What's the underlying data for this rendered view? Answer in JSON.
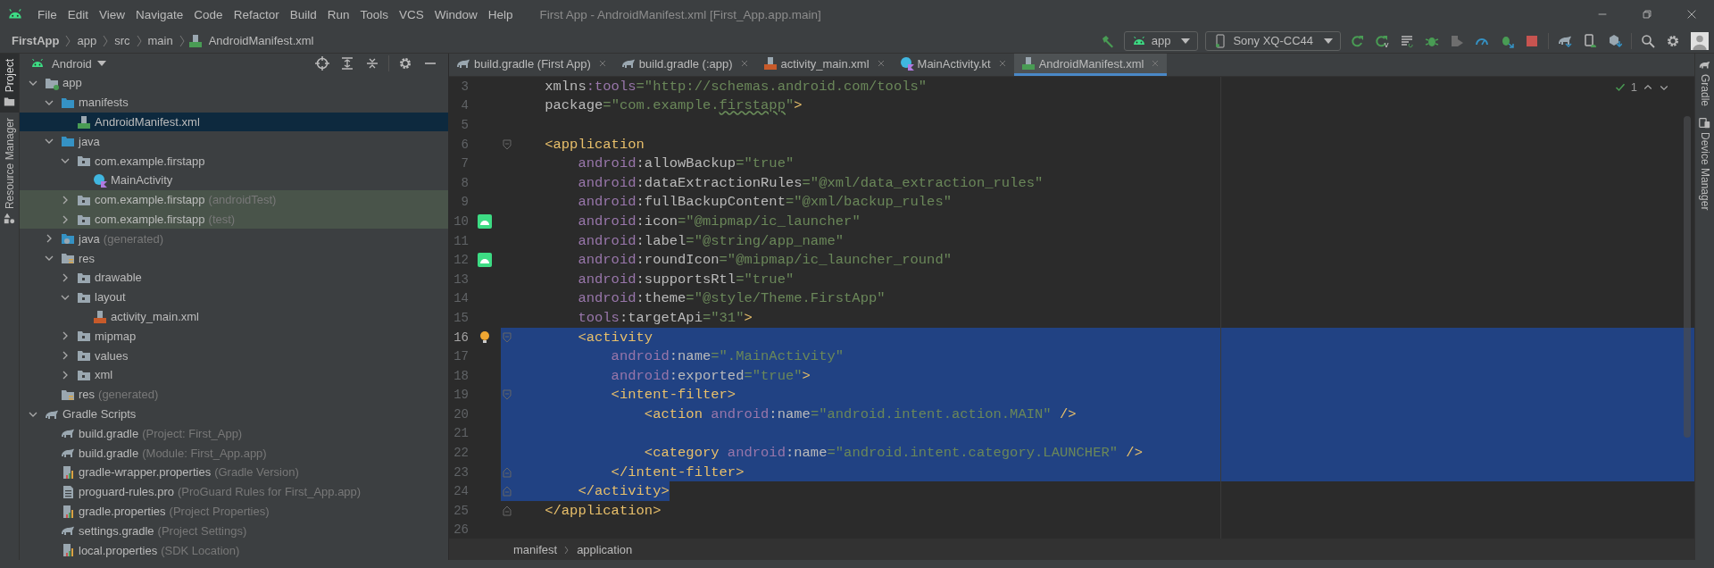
{
  "window": {
    "title": "First App - AndroidManifest.xml [First_App.app.main]"
  },
  "menu": [
    "File",
    "Edit",
    "View",
    "Navigate",
    "Code",
    "Refactor",
    "Build",
    "Run",
    "Tools",
    "VCS",
    "Window",
    "Help"
  ],
  "navbar": {
    "crumbs": [
      "FirstApp",
      "app",
      "src",
      "main",
      "AndroidManifest.xml"
    ],
    "run_config": "app",
    "device": "Sony XQ-CC44"
  },
  "left_stripe": [
    {
      "label": "Project",
      "selected": true
    },
    {
      "label": "Resource Manager",
      "selected": false
    }
  ],
  "right_stripe": [
    {
      "label": "Gradle",
      "selected": false
    },
    {
      "label": "Device Manager",
      "selected": false
    }
  ],
  "project": {
    "view": "Android",
    "tree": [
      {
        "label": "app",
        "kind": "module",
        "expanded": true,
        "selected": false,
        "tinted": false,
        "children": [
          {
            "label": "manifests",
            "kind": "source-folder",
            "expanded": true,
            "selected": false,
            "tinted": false,
            "children": [
              {
                "label": "AndroidManifest.xml",
                "kind": "manifest",
                "selected": true,
                "tinted": false
              }
            ]
          },
          {
            "label": "java",
            "kind": "source-folder",
            "expanded": true,
            "selected": false,
            "tinted": false,
            "children": [
              {
                "label": "com.example.firstapp",
                "kind": "package",
                "expanded": true,
                "selected": false,
                "tinted": false,
                "children": [
                  {
                    "label": "MainActivity",
                    "kind": "class",
                    "selected": false,
                    "tinted": false
                  }
                ]
              },
              {
                "label": "com.example.firstapp",
                "note": "(androidTest)",
                "kind": "package",
                "expanded": false,
                "selected": false,
                "tinted": true
              },
              {
                "label": "com.example.firstapp",
                "note": "(test)",
                "kind": "package",
                "expanded": false,
                "selected": false,
                "tinted": true
              }
            ]
          },
          {
            "label": "java",
            "note": "(generated)",
            "kind": "generated-folder",
            "expanded": false,
            "selected": false,
            "tinted": false
          },
          {
            "label": "res",
            "kind": "resource-folder",
            "expanded": true,
            "selected": false,
            "tinted": false,
            "children": [
              {
                "label": "drawable",
                "kind": "package",
                "expanded": false,
                "selected": false,
                "tinted": false
              },
              {
                "label": "layout",
                "kind": "package",
                "expanded": true,
                "selected": false,
                "tinted": false,
                "children": [
                  {
                    "label": "activity_main.xml",
                    "kind": "layout",
                    "selected": false,
                    "tinted": false
                  }
                ]
              },
              {
                "label": "mipmap",
                "kind": "package",
                "expanded": false,
                "selected": false,
                "tinted": false
              },
              {
                "label": "values",
                "kind": "package",
                "expanded": false,
                "selected": false,
                "tinted": false
              },
              {
                "label": "xml",
                "kind": "package",
                "expanded": false,
                "selected": false,
                "tinted": false
              }
            ]
          },
          {
            "label": "res",
            "note": "(generated)",
            "kind": "resource-folder",
            "selected": false,
            "tinted": false
          }
        ]
      },
      {
        "label": "Gradle Scripts",
        "kind": "gradle",
        "expanded": true,
        "selected": false,
        "tinted": false,
        "children": [
          {
            "label": "build.gradle",
            "note": "(Project: First_App)",
            "kind": "gradle",
            "selected": false,
            "tinted": false
          },
          {
            "label": "build.gradle",
            "note": "(Module: First_App.app)",
            "kind": "gradle",
            "selected": false,
            "tinted": false
          },
          {
            "label": "gradle-wrapper.properties",
            "note": "(Gradle Version)",
            "kind": "properties",
            "selected": false,
            "tinted": false
          },
          {
            "label": "proguard-rules.pro",
            "note": "(ProGuard Rules for First_App.app)",
            "kind": "text",
            "selected": false,
            "tinted": false
          },
          {
            "label": "gradle.properties",
            "note": "(Project Properties)",
            "kind": "properties",
            "selected": false,
            "tinted": false
          },
          {
            "label": "settings.gradle",
            "note": "(Project Settings)",
            "kind": "gradle",
            "selected": false,
            "tinted": false
          },
          {
            "label": "local.properties",
            "note": "(SDK Location)",
            "kind": "properties",
            "selected": false,
            "tinted": false
          }
        ]
      }
    ]
  },
  "editor": {
    "tabs": [
      {
        "label": "build.gradle (First App)",
        "kind": "gradle",
        "selected": false
      },
      {
        "label": "build.gradle (:app)",
        "kind": "gradle",
        "selected": false
      },
      {
        "label": "activity_main.xml",
        "kind": "layout",
        "selected": false
      },
      {
        "label": "MainActivity.kt",
        "kind": "class",
        "selected": false
      },
      {
        "label": "AndroidManifest.xml",
        "kind": "manifest",
        "selected": true
      }
    ],
    "inspections": "1",
    "lines": [
      {
        "number": "3",
        "selected": false,
        "current": false,
        "tokens": [
          {
            "kind": "attr",
            "text": "    xmlns"
          },
          {
            "kind": "ns",
            "text": ":tools"
          },
          {
            "kind": "value",
            "text": "=\"http://schemas.android.com/tools\""
          }
        ]
      },
      {
        "number": "4",
        "selected": false,
        "current": false,
        "tokens": [
          {
            "kind": "attr",
            "text": "    package"
          },
          {
            "kind": "value",
            "text": "=\"com.example."
          },
          {
            "kind": "typo",
            "text": "firstapp"
          },
          {
            "kind": "value",
            "text": "\""
          },
          {
            "kind": "tag",
            "text": ">"
          }
        ]
      },
      {
        "number": "5",
        "selected": false,
        "current": false
      },
      {
        "number": "6",
        "selected": false,
        "current": false,
        "fold": {
          "kind": "start"
        },
        "tokens": [
          {
            "kind": "tag",
            "text": "    <application"
          }
        ]
      },
      {
        "number": "7",
        "selected": false,
        "current": false,
        "tokens": [
          {
            "kind": "ns",
            "text": "        android"
          },
          {
            "kind": "attr",
            "text": ":allowBackup"
          },
          {
            "kind": "value",
            "text": "=\"true\""
          }
        ]
      },
      {
        "number": "8",
        "selected": false,
        "current": false,
        "tokens": [
          {
            "kind": "ns",
            "text": "        android"
          },
          {
            "kind": "attr",
            "text": ":dataExtractionRules"
          },
          {
            "kind": "value",
            "text": "=\"@xml/data_extraction_rules\""
          }
        ]
      },
      {
        "number": "9",
        "selected": false,
        "current": false,
        "tokens": [
          {
            "kind": "ns",
            "text": "        android"
          },
          {
            "kind": "attr",
            "text": ":fullBackupContent"
          },
          {
            "kind": "value",
            "text": "=\"@xml/backup_rules\""
          }
        ]
      },
      {
        "number": "10",
        "selected": false,
        "current": false,
        "gutter": {
          "kind": "android"
        },
        "tokens": [
          {
            "kind": "ns",
            "text": "        android"
          },
          {
            "kind": "attr",
            "text": ":icon"
          },
          {
            "kind": "value",
            "text": "=\"@mipmap/ic_launcher\""
          }
        ]
      },
      {
        "number": "11",
        "selected": false,
        "current": false,
        "tokens": [
          {
            "kind": "ns",
            "text": "        android"
          },
          {
            "kind": "attr",
            "text": ":label"
          },
          {
            "kind": "value",
            "text": "=\"@string/app_name\""
          }
        ]
      },
      {
        "number": "12",
        "selected": false,
        "current": false,
        "gutter": {
          "kind": "android"
        },
        "tokens": [
          {
            "kind": "ns",
            "text": "        android"
          },
          {
            "kind": "attr",
            "text": ":roundIcon"
          },
          {
            "kind": "value",
            "text": "=\"@mipmap/ic_launcher_round\""
          }
        ]
      },
      {
        "number": "13",
        "selected": false,
        "current": false,
        "tokens": [
          {
            "kind": "ns",
            "text": "        android"
          },
          {
            "kind": "attr",
            "text": ":supportsRtl"
          },
          {
            "kind": "value",
            "text": "=\"true\""
          }
        ]
      },
      {
        "number": "14",
        "selected": false,
        "current": false,
        "tokens": [
          {
            "kind": "ns",
            "text": "        android"
          },
          {
            "kind": "attr",
            "text": ":theme"
          },
          {
            "kind": "value",
            "text": "=\"@style/Theme.FirstApp\""
          }
        ]
      },
      {
        "number": "15",
        "selected": false,
        "current": false,
        "tokens": [
          {
            "kind": "ns",
            "text": "        tools"
          },
          {
            "kind": "attr",
            "text": ":targetApi"
          },
          {
            "kind": "value",
            "text": "=\"31\""
          },
          {
            "kind": "tag",
            "text": ">"
          }
        ]
      },
      {
        "number": "16",
        "selected": true,
        "current": true,
        "fold": {
          "kind": "start"
        },
        "gutter": {
          "kind": "bulb"
        },
        "tokens": [
          {
            "kind": "tag",
            "text": "        <activity"
          }
        ]
      },
      {
        "number": "17",
        "selected": true,
        "current": false,
        "tokens": [
          {
            "kind": "ns",
            "text": "            android"
          },
          {
            "kind": "attr",
            "text": ":name"
          },
          {
            "kind": "value",
            "text": "=\".MainActivity\""
          }
        ]
      },
      {
        "number": "18",
        "selected": true,
        "current": false,
        "tokens": [
          {
            "kind": "ns",
            "text": "            android"
          },
          {
            "kind": "attr",
            "text": ":exported"
          },
          {
            "kind": "value",
            "text": "=\"true\""
          },
          {
            "kind": "tag",
            "text": ">"
          }
        ]
      },
      {
        "number": "19",
        "selected": true,
        "current": false,
        "fold": {
          "kind": "start"
        },
        "tokens": [
          {
            "kind": "tag",
            "text": "            <intent-filter>"
          }
        ]
      },
      {
        "number": "20",
        "selected": true,
        "current": false,
        "tokens": [
          {
            "kind": "tag",
            "text": "                <action"
          },
          {
            "kind": "ns",
            "text": " android"
          },
          {
            "kind": "attr",
            "text": ":name"
          },
          {
            "kind": "value",
            "text": "=\"android.intent.action.MAIN\""
          },
          {
            "kind": "tag",
            "text": " />"
          }
        ]
      },
      {
        "number": "21",
        "selected": true,
        "current": false
      },
      {
        "number": "22",
        "selected": true,
        "current": false,
        "tokens": [
          {
            "kind": "tag",
            "text": "                <category"
          },
          {
            "kind": "ns",
            "text": " android"
          },
          {
            "kind": "attr",
            "text": ":name"
          },
          {
            "kind": "value",
            "text": "=\"android.intent.category.LAUNCHER\""
          },
          {
            "kind": "tag",
            "text": " />"
          }
        ]
      },
      {
        "number": "23",
        "selected": true,
        "current": false,
        "fold": {
          "kind": "end"
        },
        "tokens": [
          {
            "kind": "tag",
            "text": "            </intent-filter>"
          }
        ]
      },
      {
        "number": "24",
        "selected": true,
        "current": false,
        "fold": {
          "kind": "end"
        },
        "tokens": [
          {
            "kind": "tag",
            "text": "        </activity>"
          }
        ]
      },
      {
        "number": "25",
        "selected": false,
        "current": false,
        "fold": {
          "kind": "end"
        },
        "tokens": [
          {
            "kind": "tag",
            "text": "    </application>"
          }
        ]
      },
      {
        "number": "26",
        "selected": false,
        "current": false
      }
    ],
    "breadcrumbs": [
      "manifest",
      "application"
    ]
  }
}
